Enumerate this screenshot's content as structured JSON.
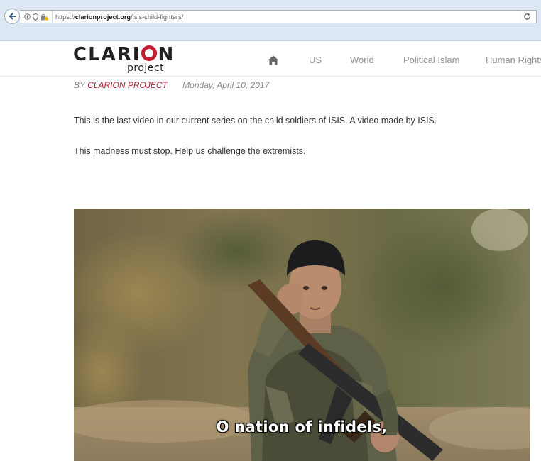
{
  "browser": {
    "url_prefix": "https://",
    "url_domain": "clarionproject.org",
    "url_path": "/isis-child-fighters/"
  },
  "site": {
    "logo_main_1": "CLARI",
    "logo_main_2": "N",
    "logo_sub": "project",
    "nav": [
      "US",
      "World",
      "Political Islam",
      "Human Rights"
    ]
  },
  "article": {
    "byline_prefix": "BY",
    "author": "CLARION PROJECT",
    "date": "Monday, April 10, 2017",
    "paragraphs": [
      "This is the last video in our current series on the child soldiers of ISIS. A video made by ISIS.",
      "This madness must stop. Help us challenge the extremists."
    ]
  },
  "video": {
    "subtitle": "O nation of infidels,"
  },
  "colors": {
    "brand_red": "#c41c30",
    "chrome_bg": "#dde7f3"
  }
}
